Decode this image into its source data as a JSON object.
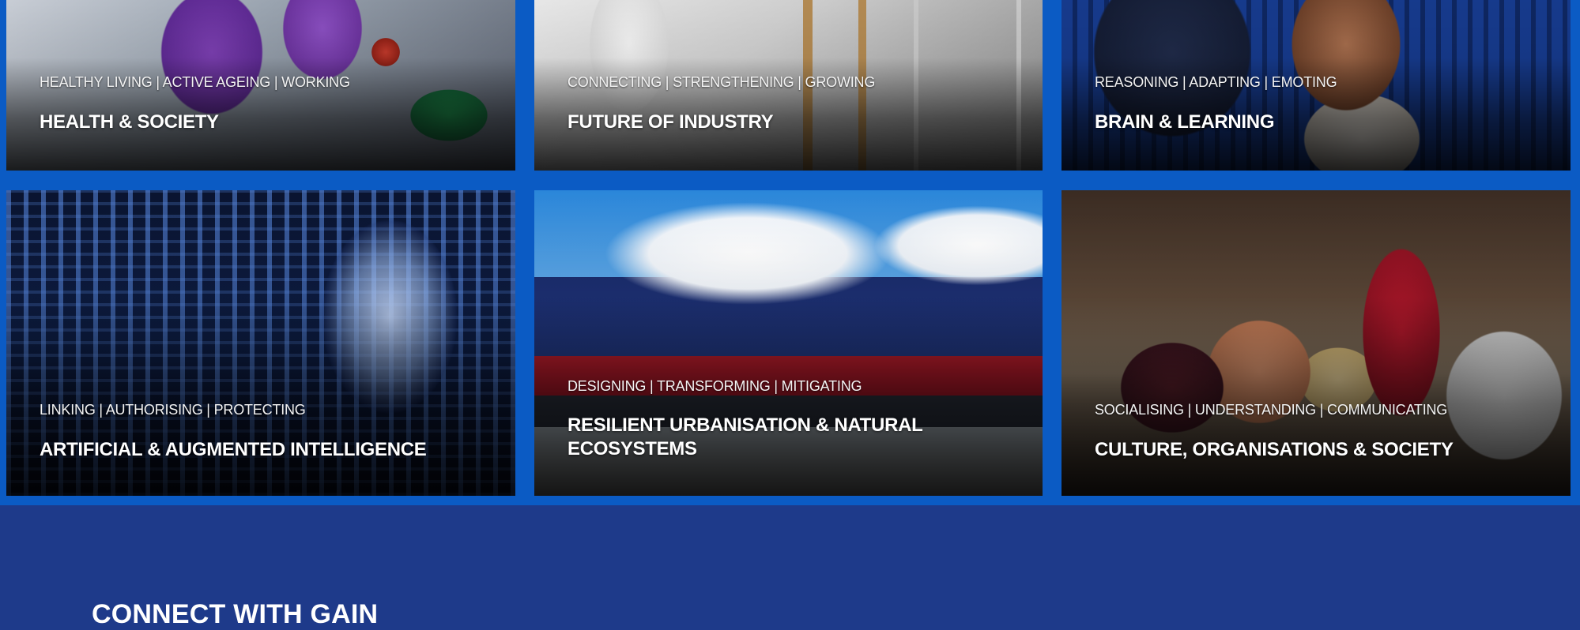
{
  "colors": {
    "grid_background": "#0b5bc4",
    "footer_background": "#1e3a8a",
    "text": "#ffffff"
  },
  "cards": [
    {
      "tagline": "HEALTHY LIVING | ACTIVE AGEING | WORKING",
      "title": "HEALTH & SOCIETY"
    },
    {
      "tagline": "CONNECTING | STRENGTHENING | GROWING",
      "title": "FUTURE OF INDUSTRY"
    },
    {
      "tagline": "REASONING | ADAPTING | EMOTING",
      "title": "BRAIN & LEARNING"
    },
    {
      "tagline": "LINKING | AUTHORISING | PROTECTING",
      "title": "ARTIFICIAL & AUGMENTED INTELLIGENCE"
    },
    {
      "tagline": "DESIGNING | TRANSFORMING | MITIGATING",
      "title": "RESILIENT URBANISATION & NATURAL ECOSYSTEMS"
    },
    {
      "tagline": "SOCIALISING | UNDERSTANDING | COMMUNICATING",
      "title": "CULTURE, ORGANISATIONS & SOCIETY"
    }
  ],
  "connect": {
    "heading": "CONNECT WITH GAIN"
  }
}
